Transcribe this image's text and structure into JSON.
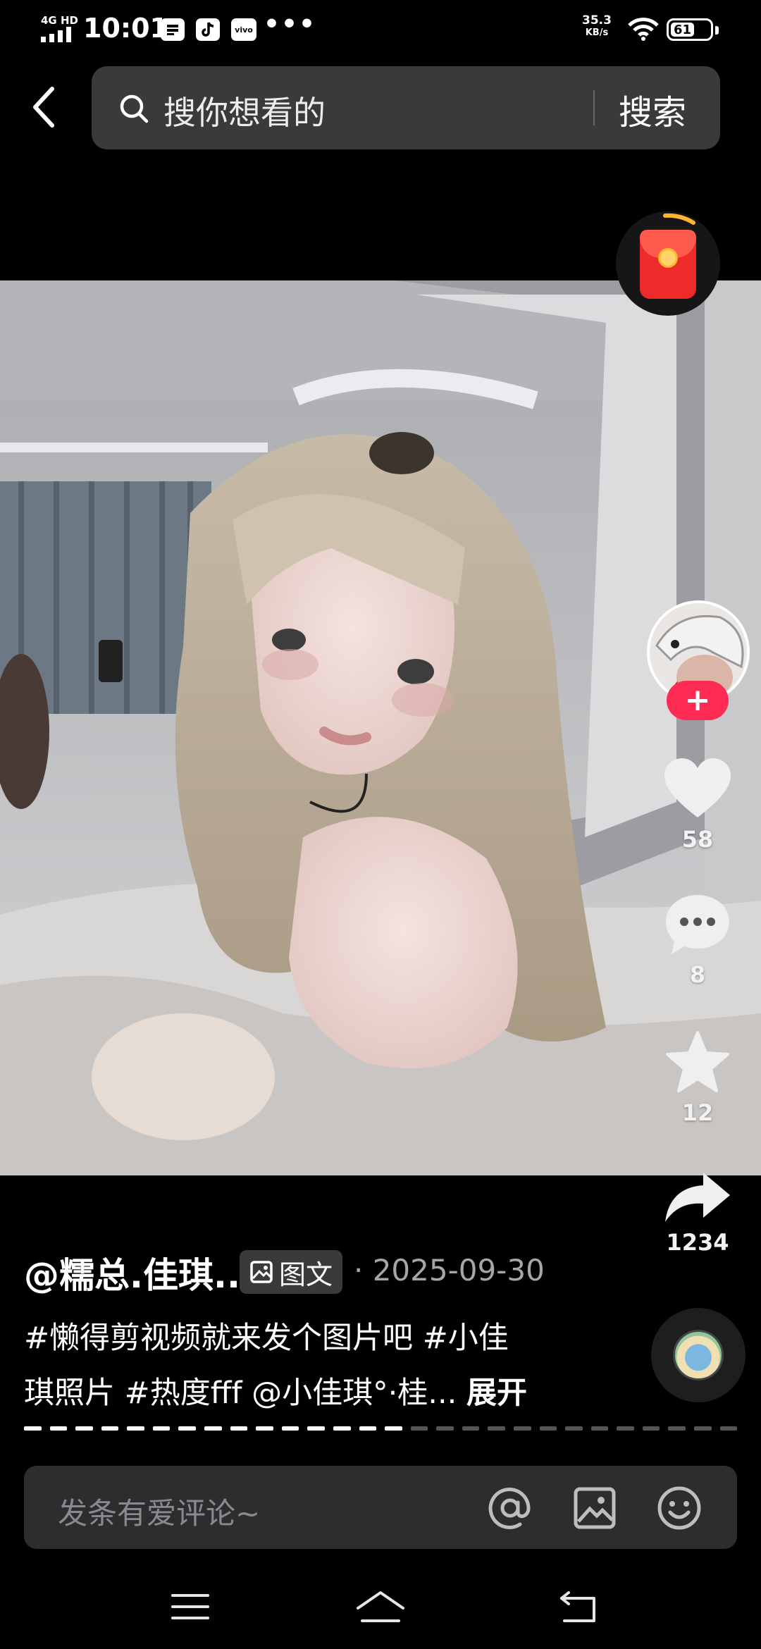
{
  "status_bar": {
    "network": "4G HD",
    "time": "10:01",
    "app_icons": [
      "sim-card-icon",
      "tiktok-icon",
      "vivo-icon"
    ],
    "more": "•••",
    "speed_value": "35.3",
    "speed_unit": "KB/s",
    "battery": "61"
  },
  "search": {
    "placeholder": "搜你想看的",
    "button_label": "搜索"
  },
  "post": {
    "author": "@糯总.佳琪...",
    "type_label": "图文",
    "date": "· 2025-09-30",
    "caption_line1": "#懒得剪视频就来发个图片吧 #小佳",
    "caption_line2": "琪照片 #热度fff @小佳琪°·桂... ",
    "expand_label": "展开",
    "progress": {
      "total_pages": 28,
      "current_page": 15
    }
  },
  "actions": {
    "follow_label": "+",
    "likes": "58",
    "comments": "8",
    "favorites": "12",
    "shares": "1234"
  },
  "comment_bar": {
    "placeholder": "发条有爱评论~"
  },
  "colors": {
    "background": "#000000",
    "follow_red": "#fe2c55",
    "input_bg": "#2d2d30",
    "progress_active": "#ffffff",
    "progress_inactive": "#555555"
  }
}
